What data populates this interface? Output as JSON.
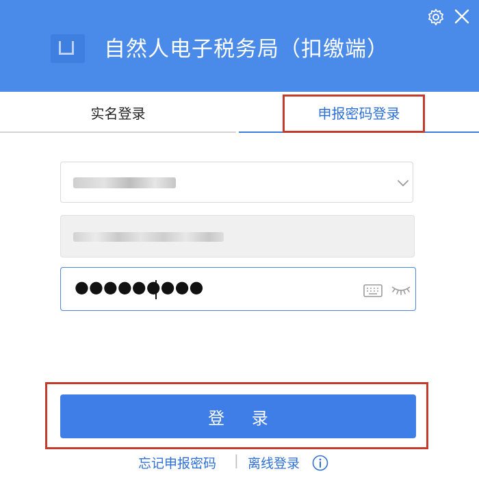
{
  "window": {
    "title": "自然人电子税务局（扣缴端）",
    "settings_icon": "gear-icon",
    "close_icon": "close-icon",
    "header_color": "#4a8ae8"
  },
  "tabs": [
    {
      "label": "实名登录",
      "active": false
    },
    {
      "label": "申报密码登录",
      "active": true
    }
  ],
  "form": {
    "account_select": {
      "value": "",
      "icon": "chevron-down-icon"
    },
    "id_field": {
      "value": ""
    },
    "password": {
      "value": "●●●●●●●●●",
      "icons": [
        "keyboard-icon",
        "eye-closed-icon"
      ]
    }
  },
  "login_button": {
    "label": "登 录",
    "color": "#3f7ee6"
  },
  "footer": {
    "forgot_password": "忘记申报密码",
    "separator": "|",
    "offline_login": "离线登录",
    "info_icon": "info-icon"
  },
  "highlight_color": "#c23b2b"
}
